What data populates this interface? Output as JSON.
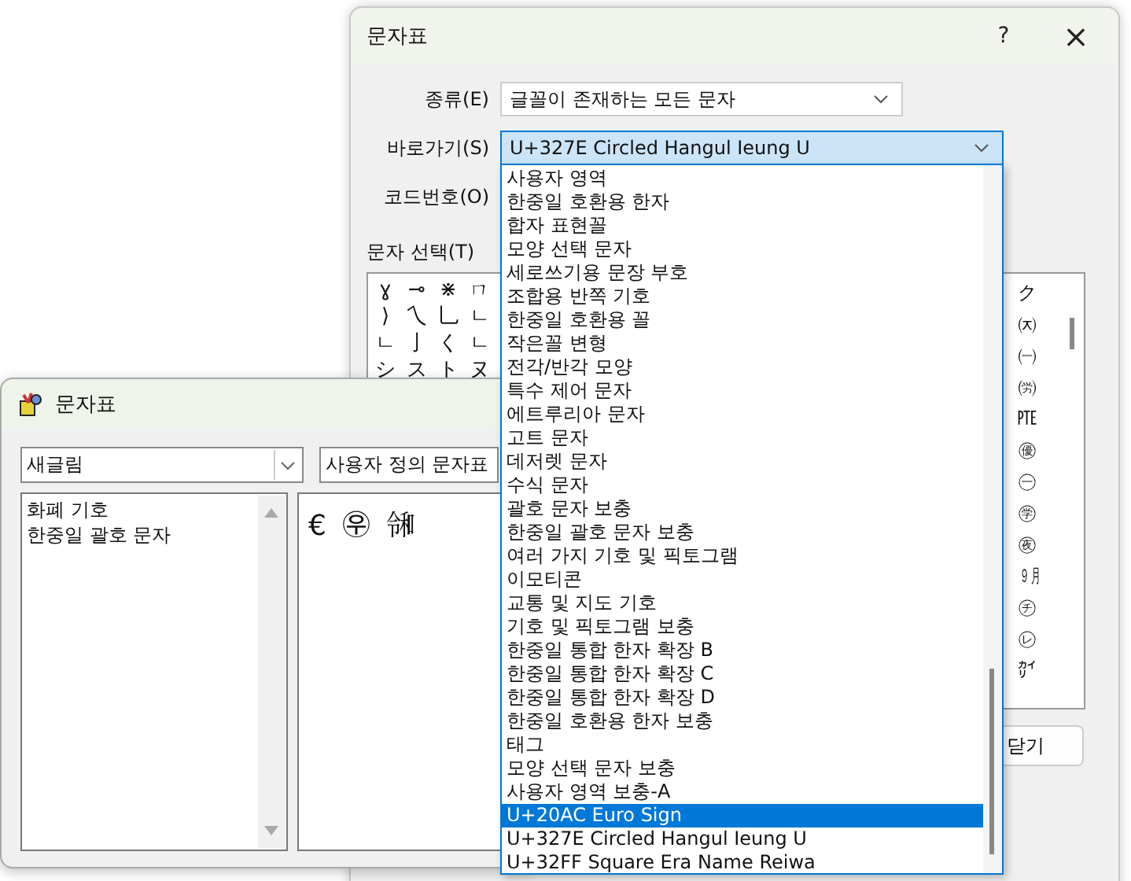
{
  "back_dialog": {
    "title": "문자표",
    "help": "?",
    "close": "×",
    "kind_label": "종류(E)",
    "kind_value": "글꼴이 존재하는 모든 문자",
    "goto_label": "바로가기(S)",
    "goto_value": "U+327E  Circled Hangul Ieung U",
    "code_label": "코드번호(O)",
    "grid_label": "문자 선택(T)",
    "grid_left_rows": [
      [
        "ɣ",
        "⊸",
        "⋇",
        "ㄇ"
      ],
      [
        "⟩",
        "乀",
        "乚",
        "ㄴ"
      ],
      [
        "ㄴ",
        "亅",
        "く",
        "ㄴ"
      ],
      [
        "シ",
        "ス",
        "ト",
        "ヌ"
      ]
    ],
    "grid_right_column": [
      "ク",
      "㈈",
      "㈠",
      "㈸",
      "㉐",
      "㊝",
      "㊀",
      "㊫",
      "㊰",
      "㋈",
      "㋠",
      "㋹",
      "㌋"
    ],
    "close_button": "닫기"
  },
  "front_window": {
    "title": "문자표",
    "font_value": "새글림",
    "table_value": "사용자 정의 문자표",
    "categories": [
      {
        "label": "화폐 기호",
        "selected": false
      },
      {
        "label": "한중일 괄호 문자",
        "selected": false
      }
    ],
    "characters": [
      "€",
      "㉾",
      "㋿"
    ]
  },
  "dropdown_list": [
    {
      "label": "사용자 영역",
      "selected": false
    },
    {
      "label": "한중일 호환용 한자",
      "selected": false
    },
    {
      "label": "합자 표현꼴",
      "selected": false
    },
    {
      "label": "모양 선택 문자",
      "selected": false
    },
    {
      "label": "세로쓰기용 문장 부호",
      "selected": false
    },
    {
      "label": "조합용 반쪽 기호",
      "selected": false
    },
    {
      "label": "한중일 호환용 꼴",
      "selected": false
    },
    {
      "label": "작은꼴 변형",
      "selected": false
    },
    {
      "label": "전각/반각 모양",
      "selected": false
    },
    {
      "label": "특수 제어 문자",
      "selected": false
    },
    {
      "label": "에트루리아 문자",
      "selected": false
    },
    {
      "label": "고트 문자",
      "selected": false
    },
    {
      "label": "데저렛 문자",
      "selected": false
    },
    {
      "label": "수식 문자",
      "selected": false
    },
    {
      "label": "괄호 문자 보충",
      "selected": false
    },
    {
      "label": "한중일 괄호 문자 보충",
      "selected": false
    },
    {
      "label": "여러 가지 기호 및 픽토그램",
      "selected": false
    },
    {
      "label": "이모티콘",
      "selected": false
    },
    {
      "label": "교통 및 지도 기호",
      "selected": false
    },
    {
      "label": "기호 및 픽토그램 보충",
      "selected": false
    },
    {
      "label": "한중일 통합 한자 확장 B",
      "selected": false
    },
    {
      "label": "한중일 통합 한자 확장 C",
      "selected": false
    },
    {
      "label": "한중일 통합 한자 확장 D",
      "selected": false
    },
    {
      "label": "한중일 호환용 한자 보충",
      "selected": false
    },
    {
      "label": "태그",
      "selected": false
    },
    {
      "label": "모양 선택 문자 보충",
      "selected": false
    },
    {
      "label": "사용자 영역 보충-A",
      "selected": false
    },
    {
      "label": "U+20AC  Euro Sign",
      "selected": true
    },
    {
      "label": "U+327E  Circled Hangul Ieung U",
      "selected": false
    },
    {
      "label": "U+32FF  Square Era Name Reiwa",
      "selected": false
    }
  ]
}
